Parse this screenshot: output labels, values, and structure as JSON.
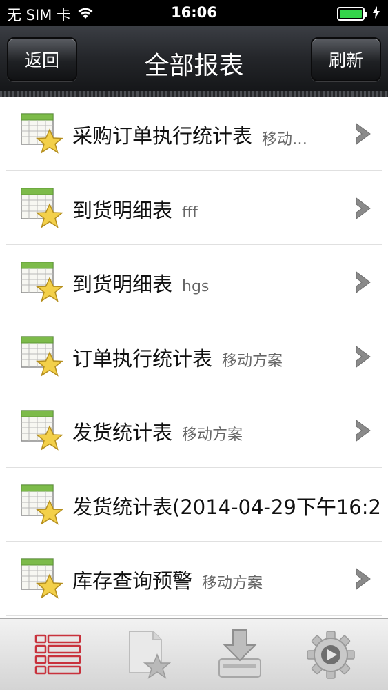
{
  "status_bar": {
    "carrier": "无 SIM 卡",
    "time": "16:06",
    "battery_level": 1.0,
    "wifi_icon": "wifi-icon",
    "charging_icon": "bolt-icon"
  },
  "nav": {
    "back_label": "返回",
    "title": "全部报表",
    "refresh_label": "刷新"
  },
  "reports": [
    {
      "title": "采购订单执行统计表",
      "subtitle": "移动…",
      "icon": "report-star-icon",
      "has_chevron": true
    },
    {
      "title": "到货明细表",
      "subtitle": "fff",
      "icon": "report-star-icon",
      "has_chevron": true
    },
    {
      "title": "到货明细表",
      "subtitle": "hgs",
      "icon": "report-star-icon",
      "has_chevron": true
    },
    {
      "title": "订单执行统计表",
      "subtitle": "移动方案",
      "icon": "report-star-icon",
      "has_chevron": true
    },
    {
      "title": "发货统计表",
      "subtitle": "移动方案",
      "icon": "report-star-icon",
      "has_chevron": true
    },
    {
      "title": "发货统计表(2014-04-29下午16:2",
      "subtitle": "",
      "icon": "report-star-icon",
      "has_chevron": false
    },
    {
      "title": "库存查询预警",
      "subtitle": "移动方案",
      "icon": "report-star-icon",
      "has_chevron": true
    }
  ],
  "tabs": [
    {
      "icon": "report-list-icon",
      "selected": true
    },
    {
      "icon": "favorites-icon",
      "selected": false
    },
    {
      "icon": "download-icon",
      "selected": false
    },
    {
      "icon": "settings-icon",
      "selected": false
    }
  ],
  "colors": {
    "battery_fill": "#34d44a",
    "selected_tab": "#c8323c",
    "chevron": "#8a8a8a"
  }
}
